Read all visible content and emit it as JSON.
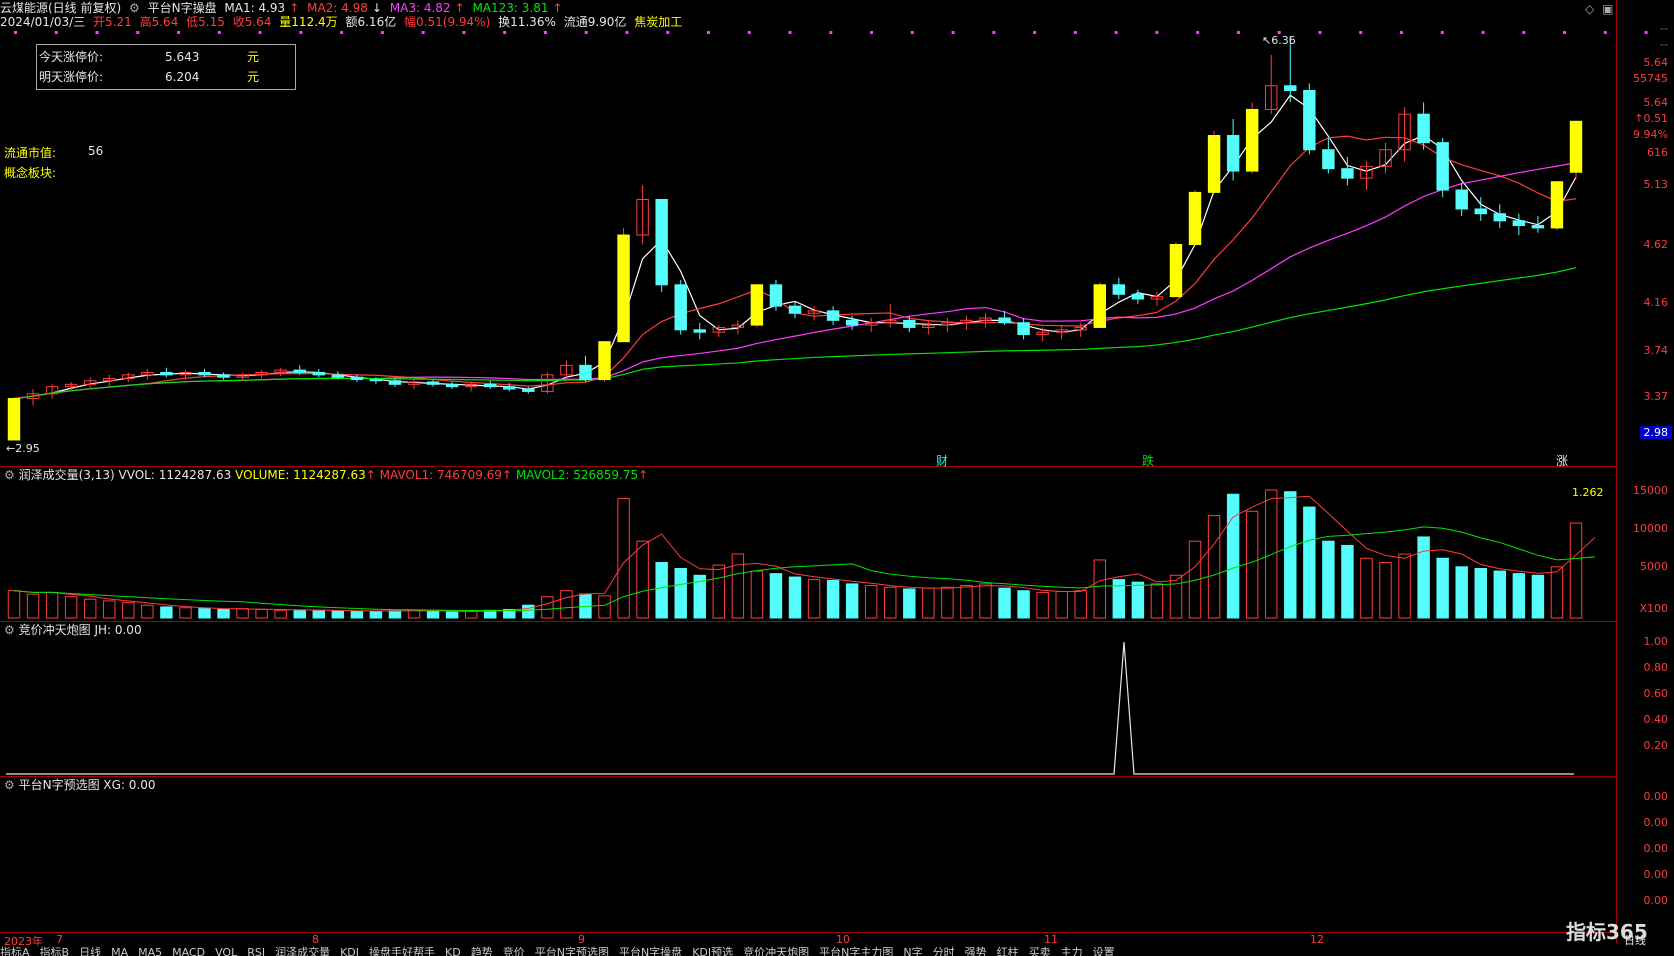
{
  "header": {
    "stock": "云煤能源(日线 前复权)",
    "indicator": "平台N字操盘",
    "ma1": "MA1: 4.93",
    "ma2": "MA2: 4.98",
    "ma3": "MA3: 4.82",
    "ma123": "MA123: 3.81",
    "date": "2024/01/03/三",
    "open": "开5.21",
    "high": "高5.64",
    "low": "低5.15",
    "close": "收5.64",
    "vol": "量112.4万",
    "amount": "额6.16亿",
    "change": "幅0.51(9.94%)",
    "turnover": "换11.36%",
    "float": "流通9.90亿",
    "sector": "焦炭加工"
  },
  "infobox": {
    "today_label": "今天涨停价:",
    "today_value": "5.643",
    "today_unit": "元",
    "tomorrow_label": "明天涨停价:",
    "tomorrow_value": "6.204",
    "tomorrow_unit": "元"
  },
  "side_info": {
    "mcap_label": "流通市值:",
    "mcap_value": "56",
    "concept_label": "概念板块:"
  },
  "price_labels": {
    "high_mark": "6.36",
    "low_mark": "2.95",
    "event_cai": "财",
    "event_die": "跌",
    "event_zhang": "涨"
  },
  "price_axis": {
    "ticks": [
      "5.13",
      "4.62",
      "4.16",
      "3.74",
      "3.37"
    ],
    "top_values": [
      "--",
      "--",
      "5.64",
      "55745",
      "5.64",
      "0.51",
      "9.94%",
      "616"
    ],
    "current_badge": "2.98"
  },
  "volume_panel": {
    "title": "润泽成交量(3,13)",
    "vvol": "VVOL: 1124287.63",
    "volume": "VOLUME: 1124287.63",
    "mavol1": "MAVOL1: 746709.69",
    "mavol2": "MAVOL2: 526859.75",
    "ticks": [
      "15000",
      "10000",
      "5000"
    ],
    "unit": "X100",
    "right_value": "1.262"
  },
  "jh_panel": {
    "title": "竞价冲天炮图",
    "value": "JH: 0.00",
    "ticks": [
      "1.00",
      "0.80",
      "0.60",
      "0.40",
      "0.20"
    ]
  },
  "xg_panel": {
    "title": "平台N字预选图",
    "value": "XG: 0.00",
    "ticks": [
      "0.00",
      "0.00",
      "0.00",
      "0.00",
      "0.00"
    ]
  },
  "time_axis": {
    "labels": [
      "2023年",
      "7",
      "8",
      "9",
      "10",
      "11",
      "12"
    ],
    "right": "日线"
  },
  "tabs": [
    "指标A",
    "指标B",
    "日线",
    "MA",
    "MA5",
    "MACD",
    "VOL",
    "RSI",
    "润泽成交量",
    "KDJ",
    "操盘手好帮手",
    "KD",
    "趋势",
    "竞价",
    "平台N字预选图",
    "平台N字操盘",
    "KDJ预选",
    "竞价冲天炮图",
    "平台N字主力图",
    "N字",
    "分时",
    "强势",
    "红柱",
    "买卖",
    "主力",
    "设置"
  ],
  "logo": "指标365",
  "chart_data": {
    "type": "candlestick",
    "title": "",
    "candles_ohlc": [
      [
        2.95,
        3.3,
        2.95,
        3.3
      ],
      [
        3.3,
        3.38,
        3.24,
        3.34
      ],
      [
        3.34,
        3.42,
        3.3,
        3.4
      ],
      [
        3.4,
        3.44,
        3.36,
        3.42
      ],
      [
        3.42,
        3.48,
        3.38,
        3.45
      ],
      [
        3.45,
        3.5,
        3.4,
        3.47
      ],
      [
        3.47,
        3.52,
        3.44,
        3.5
      ],
      [
        3.5,
        3.55,
        3.46,
        3.52
      ],
      [
        3.52,
        3.56,
        3.48,
        3.5
      ],
      [
        3.5,
        3.54,
        3.46,
        3.52
      ],
      [
        3.52,
        3.55,
        3.48,
        3.5
      ],
      [
        3.5,
        3.52,
        3.46,
        3.48
      ],
      [
        3.48,
        3.52,
        3.45,
        3.5
      ],
      [
        3.5,
        3.54,
        3.47,
        3.52
      ],
      [
        3.52,
        3.56,
        3.49,
        3.54
      ],
      [
        3.54,
        3.58,
        3.5,
        3.52
      ],
      [
        3.52,
        3.55,
        3.48,
        3.5
      ],
      [
        3.5,
        3.53,
        3.46,
        3.48
      ],
      [
        3.48,
        3.5,
        3.44,
        3.46
      ],
      [
        3.46,
        3.48,
        3.42,
        3.45
      ],
      [
        3.45,
        3.47,
        3.4,
        3.42
      ],
      [
        3.42,
        3.46,
        3.38,
        3.44
      ],
      [
        3.44,
        3.46,
        3.4,
        3.42
      ],
      [
        3.42,
        3.44,
        3.38,
        3.4
      ],
      [
        3.4,
        3.44,
        3.36,
        3.42
      ],
      [
        3.42,
        3.45,
        3.38,
        3.4
      ],
      [
        3.4,
        3.43,
        3.36,
        3.38
      ],
      [
        3.38,
        3.4,
        3.34,
        3.36
      ],
      [
        3.36,
        3.52,
        3.34,
        3.5
      ],
      [
        3.5,
        3.62,
        3.46,
        3.58
      ],
      [
        3.58,
        3.66,
        3.44,
        3.46
      ],
      [
        3.46,
        3.78,
        3.44,
        3.78
      ],
      [
        3.78,
        4.74,
        3.78,
        4.68
      ],
      [
        4.68,
        5.1,
        4.6,
        4.98
      ],
      [
        4.98,
        4.98,
        4.2,
        4.26
      ],
      [
        4.26,
        4.3,
        3.84,
        3.88
      ],
      [
        3.88,
        3.94,
        3.8,
        3.86
      ],
      [
        3.86,
        3.92,
        3.82,
        3.9
      ],
      [
        3.9,
        3.96,
        3.84,
        3.92
      ],
      [
        3.92,
        4.26,
        3.9,
        4.26
      ],
      [
        4.26,
        4.3,
        4.04,
        4.08
      ],
      [
        4.08,
        4.12,
        3.98,
        4.02
      ],
      [
        4.02,
        4.08,
        3.96,
        4.04
      ],
      [
        4.04,
        4.08,
        3.92,
        3.96
      ],
      [
        3.96,
        4.0,
        3.88,
        3.92
      ],
      [
        3.92,
        3.98,
        3.86,
        3.94
      ],
      [
        3.94,
        4.1,
        3.9,
        3.96
      ],
      [
        3.96,
        4.0,
        3.86,
        3.9
      ],
      [
        3.9,
        3.96,
        3.84,
        3.92
      ],
      [
        3.92,
        3.98,
        3.86,
        3.94
      ],
      [
        3.94,
        4.0,
        3.88,
        3.96
      ],
      [
        3.96,
        4.02,
        3.9,
        3.98
      ],
      [
        3.98,
        4.04,
        3.92,
        3.94
      ],
      [
        3.94,
        3.98,
        3.8,
        3.84
      ],
      [
        3.84,
        3.9,
        3.78,
        3.86
      ],
      [
        3.86,
        3.92,
        3.8,
        3.88
      ],
      [
        3.88,
        3.94,
        3.82,
        3.9
      ],
      [
        3.9,
        4.28,
        3.9,
        4.26
      ],
      [
        4.26,
        4.32,
        4.14,
        4.18
      ],
      [
        4.18,
        4.22,
        4.1,
        4.14
      ],
      [
        4.14,
        4.2,
        4.08,
        4.16
      ],
      [
        4.16,
        4.62,
        4.16,
        4.6
      ],
      [
        4.6,
        5.06,
        4.6,
        5.04
      ],
      [
        5.04,
        5.56,
        5.04,
        5.52
      ],
      [
        5.52,
        5.66,
        5.14,
        5.22
      ],
      [
        5.22,
        5.8,
        5.2,
        5.74
      ],
      [
        5.74,
        6.2,
        5.7,
        5.94
      ],
      [
        5.94,
        6.36,
        5.8,
        5.9
      ],
      [
        5.9,
        5.96,
        5.36,
        5.4
      ],
      [
        5.4,
        5.5,
        5.2,
        5.24
      ],
      [
        5.24,
        5.34,
        5.1,
        5.16
      ],
      [
        5.16,
        5.3,
        5.06,
        5.26
      ],
      [
        5.26,
        5.46,
        5.2,
        5.4
      ],
      [
        5.4,
        5.76,
        5.3,
        5.7
      ],
      [
        5.7,
        5.8,
        5.4,
        5.46
      ],
      [
        5.46,
        5.5,
        5.0,
        5.06
      ],
      [
        5.06,
        5.12,
        4.84,
        4.9
      ],
      [
        4.9,
        5.0,
        4.8,
        4.86
      ],
      [
        4.86,
        4.94,
        4.74,
        4.8
      ],
      [
        4.8,
        4.86,
        4.68,
        4.76
      ],
      [
        4.76,
        4.84,
        4.7,
        4.74
      ],
      [
        4.74,
        5.13,
        4.72,
        5.13
      ],
      [
        5.21,
        5.64,
        5.15,
        5.64
      ]
    ],
    "volume": [
      3200,
      2800,
      3000,
      2500,
      2200,
      2000,
      1800,
      1500,
      1300,
      1200,
      1100,
      1000,
      1100,
      1000,
      900,
      950,
      900,
      850,
      800,
      800,
      850,
      900,
      800,
      700,
      800,
      900,
      1000,
      1500,
      2500,
      3200,
      2800,
      2600,
      14000,
      9000,
      6500,
      5800,
      5000,
      6200,
      7500,
      5500,
      5200,
      4800,
      4500,
      4400,
      4000,
      3800,
      3600,
      3400,
      3500,
      3600,
      3800,
      4000,
      3500,
      3200,
      3000,
      3100,
      3200,
      6800,
      4500,
      4200,
      4000,
      5000,
      9000,
      12000,
      14500,
      12500,
      15000,
      14800,
      13000,
      9000,
      8500,
      7000,
      6500,
      7500,
      9500,
      7000,
      6000,
      5800,
      5500,
      5200,
      5000,
      6000,
      11125,
      11243
    ],
    "ylim_price": [
      2.95,
      6.36
    ],
    "ylim_volume": [
      0,
      15000
    ],
    "ma_series": [
      {
        "name": "MA1",
        "value": 4.93
      },
      {
        "name": "MA2",
        "value": 4.98
      },
      {
        "name": "MA3",
        "value": 4.82
      },
      {
        "name": "MA123",
        "value": 3.81
      }
    ]
  },
  "colors": {
    "up": "#ff3c3c",
    "down": "#54fcfc",
    "limit": "#ffff00",
    "ma1": "#ffffff",
    "ma2": "#ff3c3c",
    "ma3": "#ff3cff",
    "ma123": "#00e600"
  }
}
